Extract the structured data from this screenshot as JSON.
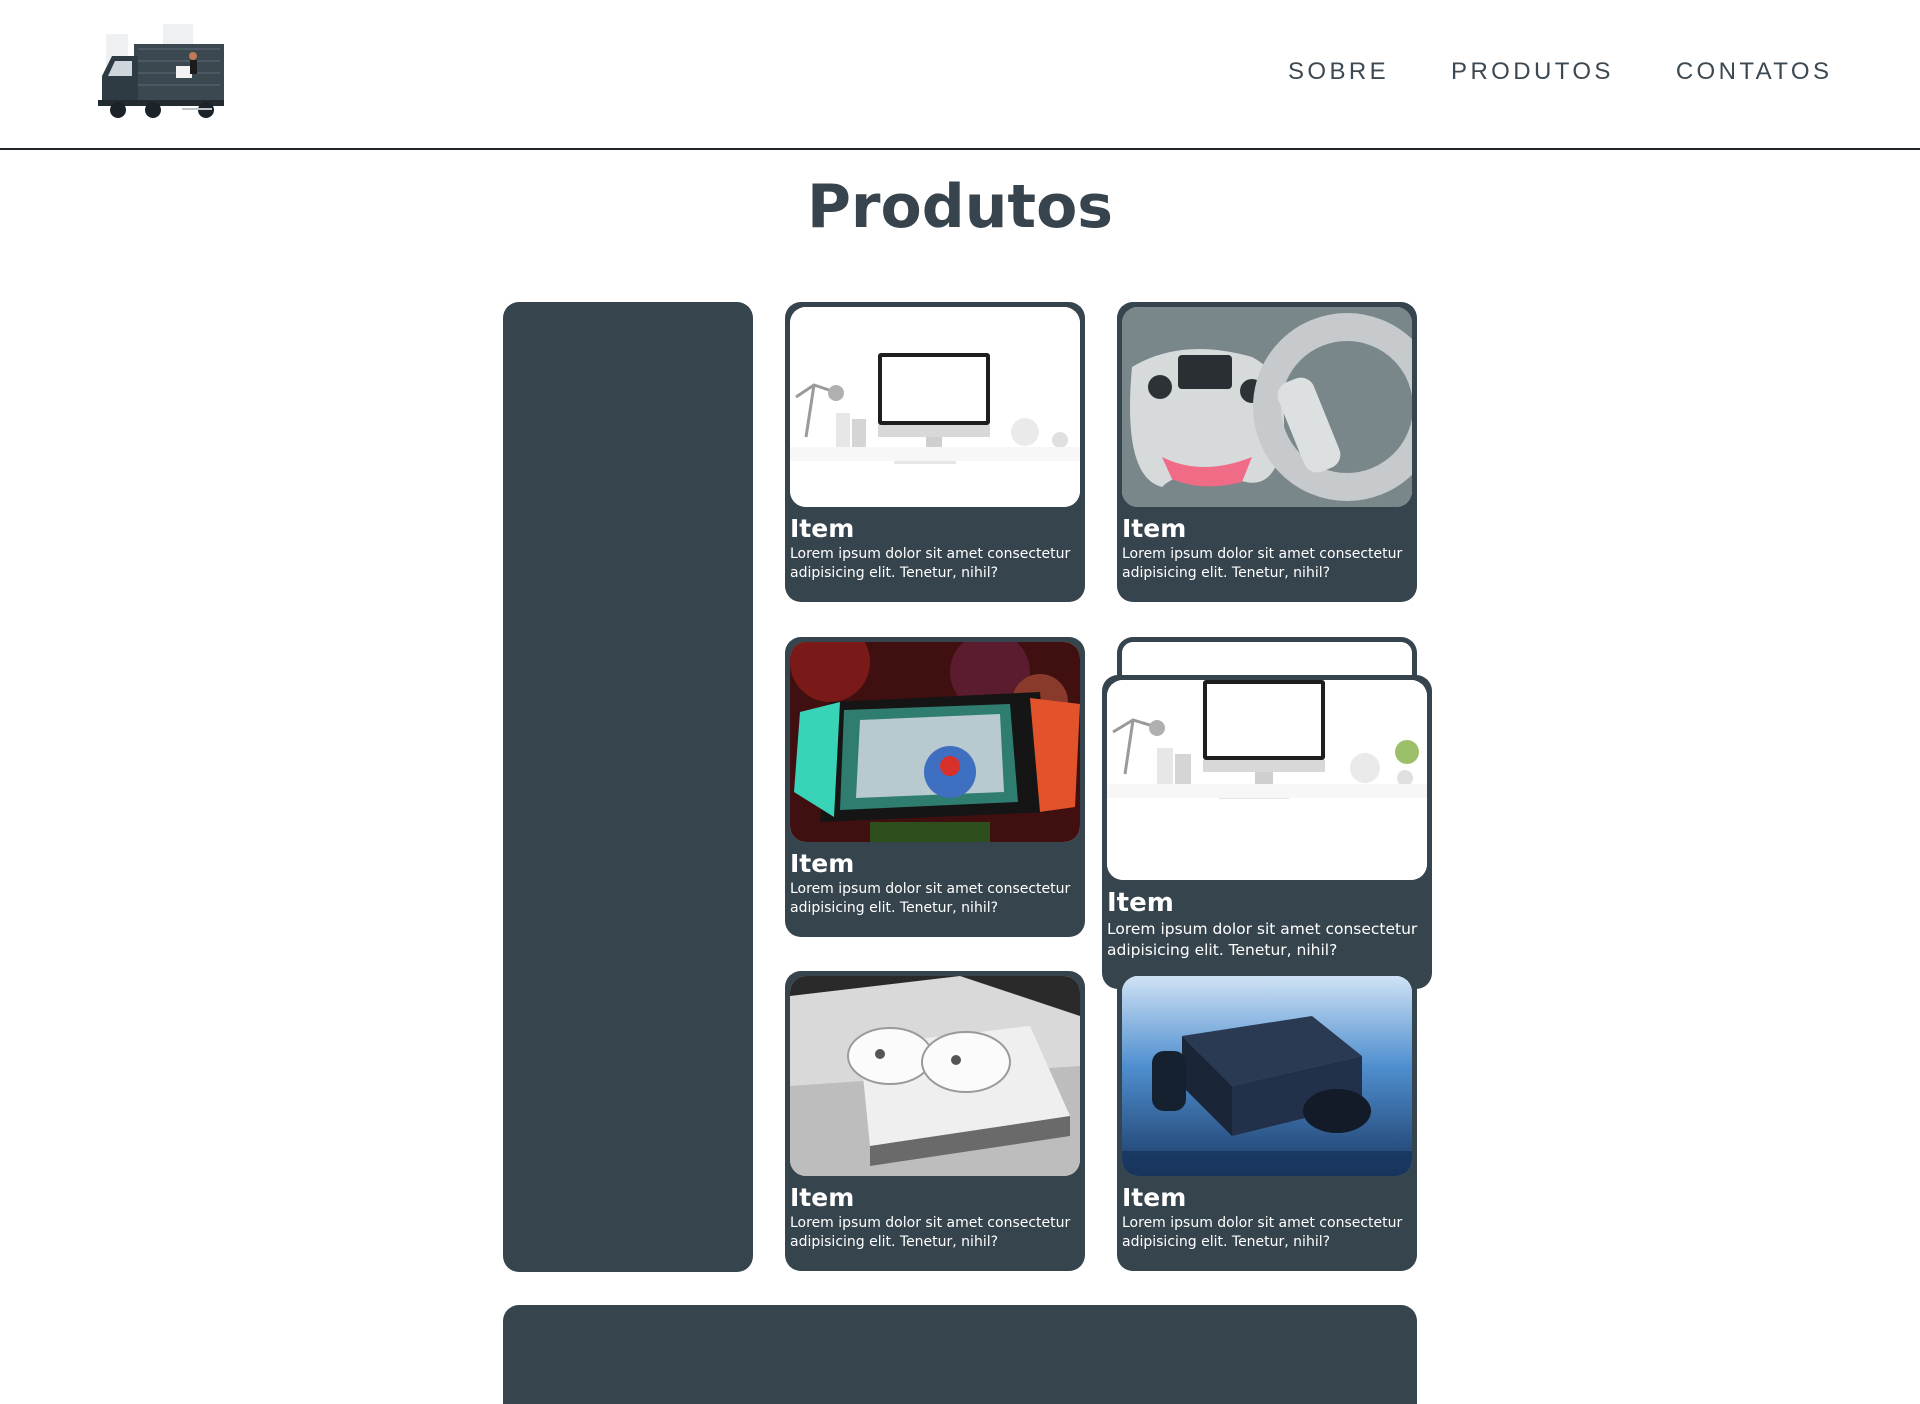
{
  "header": {
    "logo_icon": "delivery-truck-logo",
    "nav": [
      {
        "label": "SOBRE"
      },
      {
        "label": "PRODUTOS"
      },
      {
        "label": "CONTATOS"
      }
    ]
  },
  "main": {
    "title": "Produtos"
  },
  "products": [
    {
      "title": "Item",
      "desc": "Lorem ipsum dolor sit amet consectetur adipisicing elit. Tenetur, nihil?",
      "image": "desktop-computer"
    },
    {
      "title": "Item",
      "desc": "Lorem ipsum dolor sit amet consectetur adipisicing elit. Tenetur, nihil?",
      "image": "game-controllers"
    },
    {
      "title": "Item",
      "desc": "Lorem ipsum dolor sit amet consectetur adipisicing elit. Tenetur, nihil?",
      "image": "nintendo-switch"
    },
    {
      "title": "Item",
      "desc": "Lorem ipsum dolor sit amet consectetur adipisicing elit. Tenetur, nihil?",
      "image": "desktop-computer"
    },
    {
      "title": "Item",
      "desc": "Lorem ipsum dolor sit amet consectetur adipisicing elit. Tenetur, nihil?",
      "image": "xbox-white"
    },
    {
      "title": "Item",
      "desc": "Lorem ipsum dolor sit amet consectetur adipisicing elit. Tenetur, nihil?",
      "image": "xbox-black"
    }
  ],
  "colors": {
    "primary": "#36444d",
    "text_on_primary": "#ffffff",
    "header_border": "#1f272d"
  }
}
